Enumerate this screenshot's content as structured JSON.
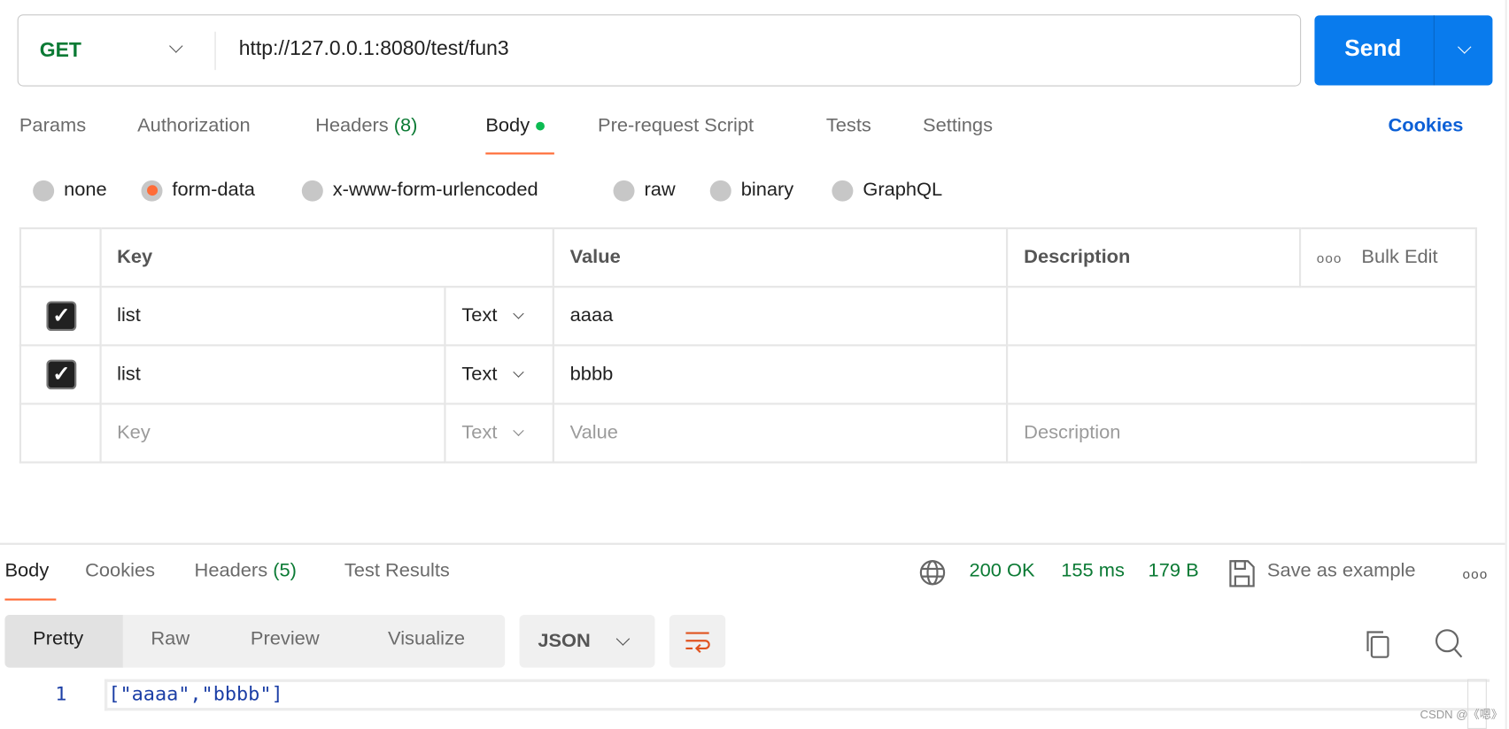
{
  "request": {
    "method": "GET",
    "url": "http://127.0.0.1:8080/test/fun3",
    "send_label": "Send"
  },
  "tabs": [
    {
      "label": "Params"
    },
    {
      "label": "Authorization"
    },
    {
      "label": "Headers",
      "count": "(8)"
    },
    {
      "label": "Body"
    },
    {
      "label": "Pre-request Script"
    },
    {
      "label": "Tests"
    },
    {
      "label": "Settings"
    }
  ],
  "cookies_label": "Cookies",
  "body_types": [
    "none",
    "form-data",
    "x-www-form-urlencoded",
    "raw",
    "binary",
    "GraphQL"
  ],
  "body_type_selected": "form-data",
  "table": {
    "headers": {
      "key": "Key",
      "value": "Value",
      "description": "Description",
      "bulk_edit": "Bulk Edit"
    },
    "rows": [
      {
        "checked": true,
        "key": "list",
        "type": "Text",
        "value": "aaaa",
        "description": ""
      },
      {
        "checked": true,
        "key": "list",
        "type": "Text",
        "value": "bbbb",
        "description": ""
      }
    ],
    "placeholder": {
      "key": "Key",
      "type": "Text",
      "value": "Value",
      "description": "Description"
    }
  },
  "response": {
    "tabs": [
      {
        "label": "Body"
      },
      {
        "label": "Cookies"
      },
      {
        "label": "Headers",
        "count": "(5)"
      },
      {
        "label": "Test Results"
      }
    ],
    "status": "200 OK",
    "time": "155 ms",
    "size": "179 B",
    "save_label": "Save as example",
    "views": [
      "Pretty",
      "Raw",
      "Preview",
      "Visualize"
    ],
    "format": "JSON",
    "code_lines": [
      {
        "n": "1",
        "text": "[\"aaaa\",\"bbbb\"]"
      }
    ]
  },
  "watermark": "CSDN @《嗯》",
  "colors": {
    "accent": "#ff6c37",
    "send": "#097bed",
    "success": "#0b7a34",
    "link": "#0b5fd6"
  }
}
